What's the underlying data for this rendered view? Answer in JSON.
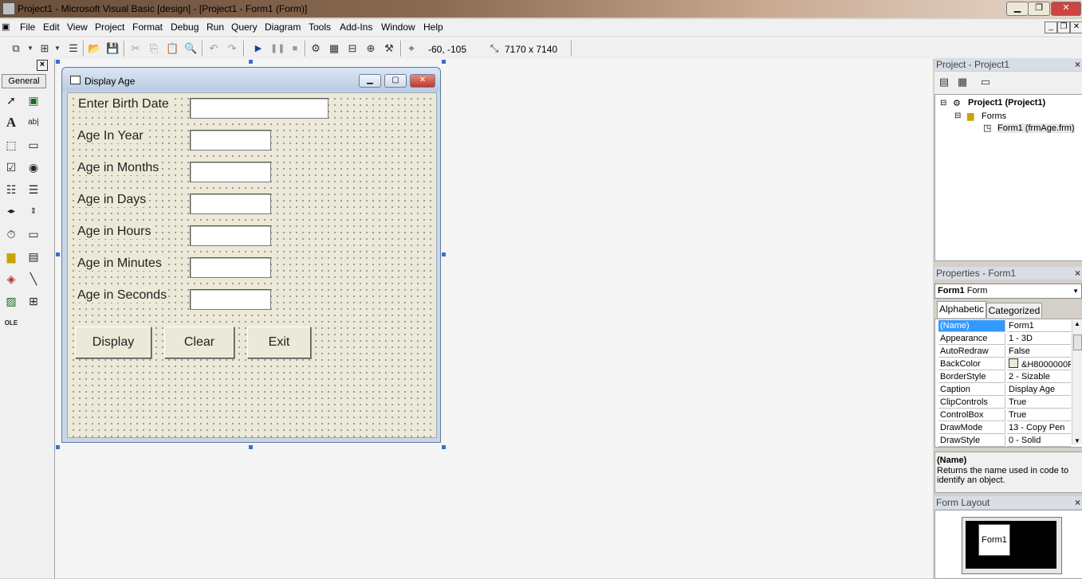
{
  "window": {
    "title": "Project1 - Microsoft Visual Basic [design] - [Project1 - Form1 (Form)]",
    "buttons": {
      "minimize": "▁",
      "restore": "❐",
      "close": "✕"
    }
  },
  "menu": [
    "File",
    "Edit",
    "View",
    "Project",
    "Format",
    "Debug",
    "Run",
    "Query",
    "Diagram",
    "Tools",
    "Add-Ins",
    "Window",
    "Help"
  ],
  "toolbar": {
    "position": "-60, -105",
    "size": "7170 x 7140"
  },
  "toolbox": {
    "tab_label": "General",
    "tools": [
      "pointer-icon",
      "picturebox-icon",
      "label-icon",
      "textbox-icon",
      "frame-icon",
      "commandbutton-icon",
      "checkbox-icon",
      "optionbutton-icon",
      "combobox-icon",
      "listbox-icon",
      "hscrollbar-icon",
      "vscrollbar-icon",
      "timer-icon",
      "drivelistbox-icon",
      "dirlistbox-icon",
      "filelistbox-icon",
      "shape-icon",
      "line-icon",
      "image-icon",
      "data-icon",
      "ole-icon"
    ]
  },
  "form": {
    "caption": "Display Age",
    "labels": [
      "Enter Birth Date",
      "Age In Year",
      "Age in Months",
      "Age in Days",
      "Age in Hours",
      "Age in Minutes",
      "Age in Seconds"
    ],
    "buttons": {
      "display": "Display",
      "clear": "Clear",
      "exit": "Exit"
    }
  },
  "project_panel": {
    "title": "Project - Project1",
    "root": "Project1 (Project1)",
    "folder": "Forms",
    "item": "Form1 (frmAge.frm)"
  },
  "properties_panel": {
    "title": "Properties - Form1",
    "object_name": "Form1",
    "object_type": "Form",
    "tabs": [
      "Alphabetic",
      "Categorized"
    ],
    "rows": [
      {
        "name": "(Name)",
        "value": "Form1"
      },
      {
        "name": "Appearance",
        "value": "1 - 3D"
      },
      {
        "name": "AutoRedraw",
        "value": "False"
      },
      {
        "name": "BackColor",
        "value": "&H8000000F"
      },
      {
        "name": "BorderStyle",
        "value": "2 - Sizable"
      },
      {
        "name": "Caption",
        "value": "Display Age"
      },
      {
        "name": "ClipControls",
        "value": "True"
      },
      {
        "name": "ControlBox",
        "value": "True"
      },
      {
        "name": "DrawMode",
        "value": "13 - Copy Pen"
      },
      {
        "name": "DrawStyle",
        "value": "0 - Solid"
      }
    ],
    "desc_title": "(Name)",
    "desc_text": "Returns the name used in code to identify an object."
  },
  "layout_panel": {
    "title": "Form Layout",
    "form_label": "Form1"
  }
}
